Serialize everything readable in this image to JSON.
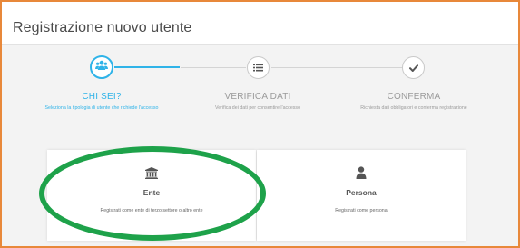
{
  "page": {
    "title": "Registrazione nuovo utente"
  },
  "steps": [
    {
      "label": "CHI SEI?",
      "description": "Seleziona la tipologia di utente che richiede l'accesso",
      "icon": "users-icon",
      "state": "active"
    },
    {
      "label": "VERIFICA DATI",
      "description": "Verifica dei dati per consentire l'accesso",
      "icon": "list-icon",
      "state": "pending"
    },
    {
      "label": "CONFERMA",
      "description": "Richiesta dati obbligatori e conferma registrazione",
      "icon": "check-icon",
      "state": "pending"
    }
  ],
  "options": [
    {
      "label": "Ente",
      "description": "Registrati come ente di terzo settore o altro ente",
      "icon": "institution-icon"
    },
    {
      "label": "Persona",
      "description": "Registrati come persona",
      "icon": "person-icon"
    }
  ],
  "colors": {
    "accent": "#2fb3e8",
    "frame_border": "#e8883a",
    "highlight_oval": "#1ea24a",
    "inactive_text": "#9a9a9a"
  }
}
